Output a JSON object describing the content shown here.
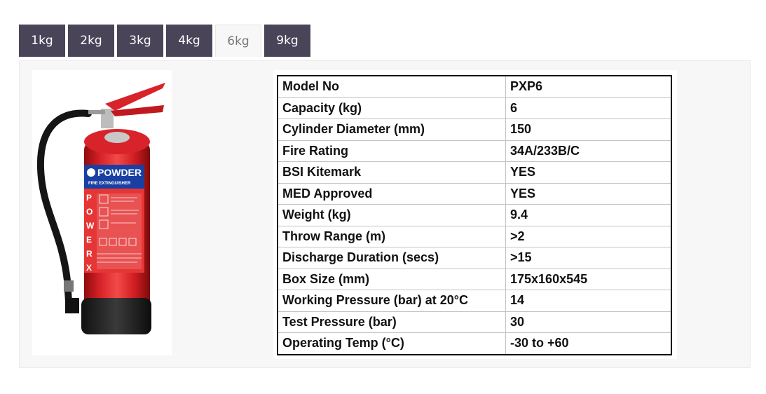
{
  "tabs": [
    {
      "label": "1kg"
    },
    {
      "label": "2kg"
    },
    {
      "label": "3kg"
    },
    {
      "label": "4kg"
    },
    {
      "label": "6kg",
      "active": true
    },
    {
      "label": "9kg"
    }
  ],
  "product": {
    "label_brand": "POWDER",
    "label_type": "FIRE EXTINGUISHER",
    "label_side": "POWERX"
  },
  "specs": [
    {
      "key": "Model No",
      "value": "PXP6"
    },
    {
      "key": "Capacity (kg)",
      "value": "6"
    },
    {
      "key": "Cylinder Diameter (mm)",
      "value": "150"
    },
    {
      "key": "Fire Rating",
      "value": "34A/233B/C"
    },
    {
      "key": "BSI Kitemark",
      "value": "YES"
    },
    {
      "key": "MED Approved",
      "value": "YES"
    },
    {
      "key": "Weight (kg)",
      "value": "9.4"
    },
    {
      "key": "Throw Range (m)",
      "value": ">2"
    },
    {
      "key": "Discharge Duration (secs)",
      "value": ">15"
    },
    {
      "key": "Box Size (mm)",
      "value": "175x160x545"
    },
    {
      "key": "Working Pressure (bar) at 20°C",
      "value": "14"
    },
    {
      "key": "Test Pressure (bar)",
      "value": "30"
    },
    {
      "key": "Operating Temp (°C)",
      "value": "-30 to +60"
    }
  ]
}
